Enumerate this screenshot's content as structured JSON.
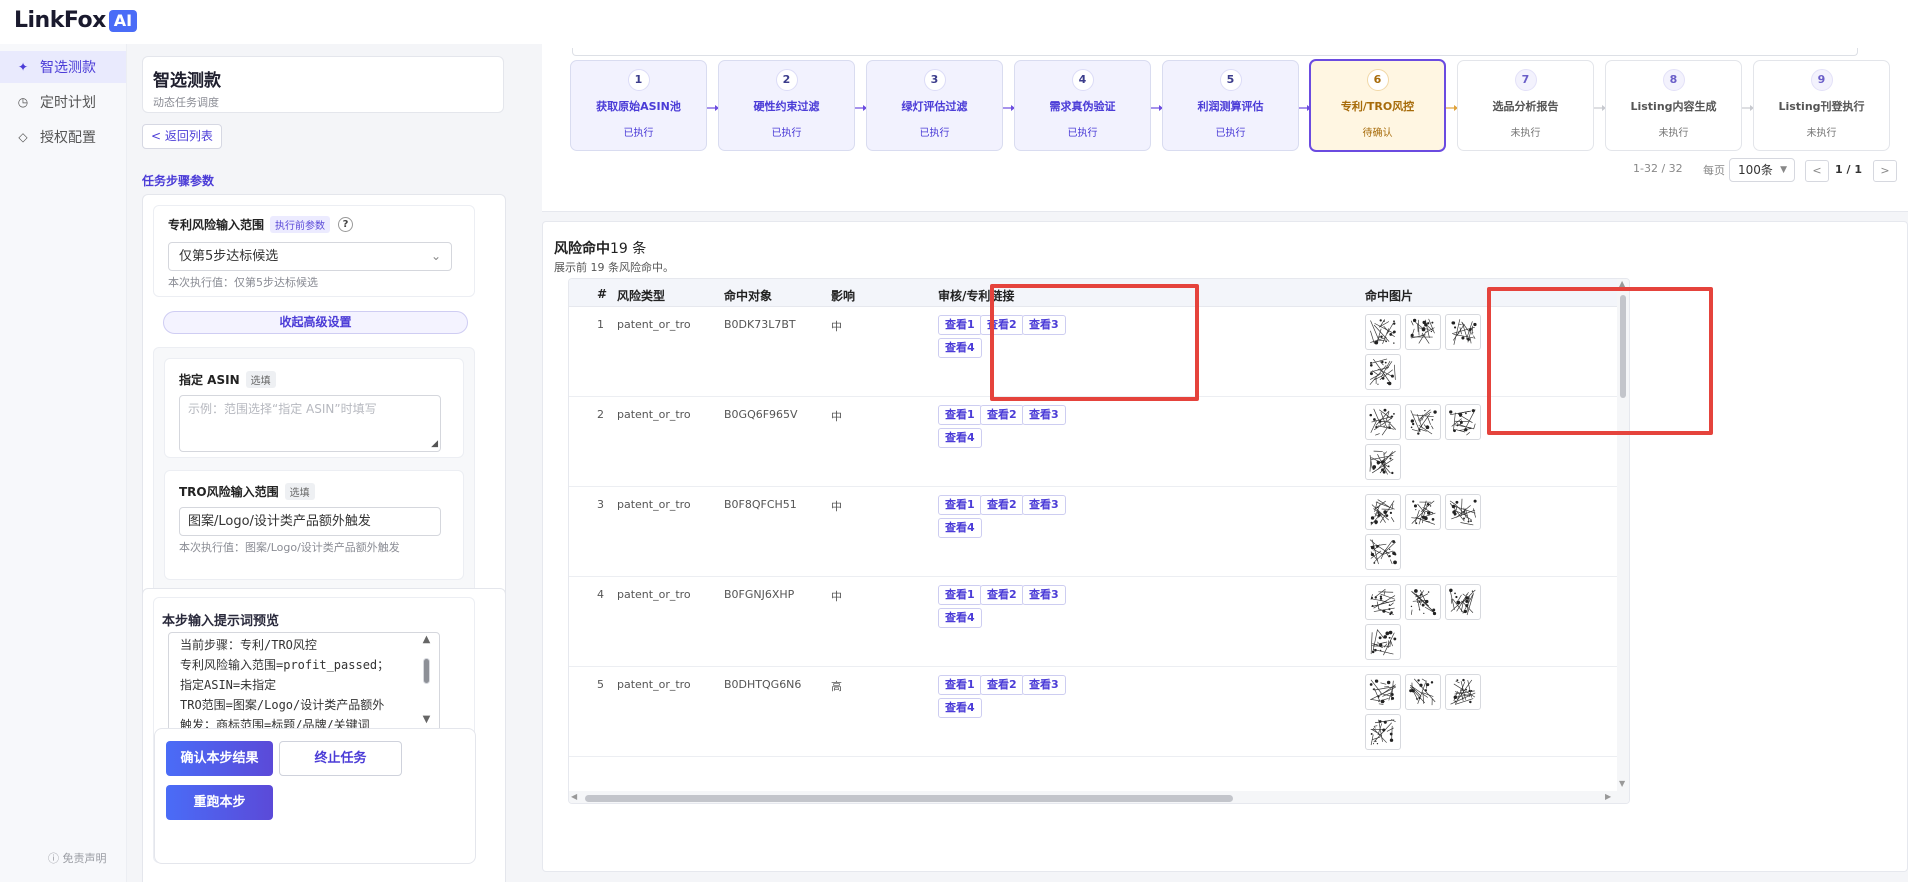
{
  "brand": {
    "name": "LinkFox",
    "badge": "AI"
  },
  "nav": {
    "items": [
      {
        "label": "智选测款",
        "icon": "sparkle-icon",
        "active": true
      },
      {
        "label": "定时计划",
        "icon": "clock-icon",
        "active": false
      },
      {
        "label": "授权配置",
        "icon": "diamond-icon",
        "active": false
      }
    ],
    "disclaimer": "免责声明"
  },
  "config": {
    "title": "智选测款",
    "subtitle": "动态任务调度",
    "back_label": "< 返回列表",
    "section_title": "任务步骤参数",
    "patent_scope": {
      "label": "专利风险输入范围",
      "tag": "执行前参数",
      "help": "?",
      "value": "仅第5步达标候选",
      "current": "本次执行值：仅第5步达标候选"
    },
    "collapse_label": "收起高级设置",
    "asin": {
      "label": "指定 ASIN",
      "tag": "选填",
      "placeholder": "示例：范围选择“指定 ASIN”时填写"
    },
    "tro": {
      "label": "TRO风险输入范围",
      "tag": "选填",
      "value": "图案/Logo/设计类产品额外触发",
      "current": "本次执行值：图案/Logo/设计类产品额外触发"
    },
    "prompt": {
      "title": "本步输入提示词预览",
      "lines": [
        "当前步骤：专利/TRO风控",
        "专利风险输入范围=profit_passed；",
        "指定ASIN=未指定",
        "TRO范围=图案/Logo/设计类产品额外",
        "触发；商标范围=标题/品牌/关键词"
      ]
    },
    "buttons": {
      "confirm": "确认本步结果",
      "stop": "终止任务",
      "rerun": "重跑本步"
    }
  },
  "steps": [
    {
      "num": "1",
      "name": "获取原始ASIN池",
      "status": "已执行",
      "state": "done"
    },
    {
      "num": "2",
      "name": "硬性约束过滤",
      "status": "已执行",
      "state": "done"
    },
    {
      "num": "3",
      "name": "绿灯评估过滤",
      "status": "已执行",
      "state": "done"
    },
    {
      "num": "4",
      "name": "需求真伪验证",
      "status": "已执行",
      "state": "done"
    },
    {
      "num": "5",
      "name": "利润测算评估",
      "status": "已执行",
      "state": "done"
    },
    {
      "num": "6",
      "name": "专利/TRO风控",
      "status": "待确认",
      "state": "active"
    },
    {
      "num": "7",
      "name": "选品分析报告",
      "status": "未执行",
      "state": "pending"
    },
    {
      "num": "8",
      "name": "Listing内容生成",
      "status": "未执行",
      "state": "pending"
    },
    {
      "num": "9",
      "name": "Listing刊登执行",
      "status": "未执行",
      "state": "pending"
    }
  ],
  "pagination": {
    "range": "1-32 / 32",
    "per_page_label": "每页",
    "per_page": "100条",
    "prev": "<",
    "page": "1 / 1",
    "next": ">"
  },
  "results": {
    "title_bold": "风险命中",
    "title_count": "19 条",
    "subtitle": "展示前 19 条风险命中。",
    "columns": [
      "#",
      "风险类型",
      "命中对象",
      "影响",
      "审核/专利链接",
      "命中图片"
    ],
    "links": [
      "查看1",
      "查看2",
      "查看3",
      "查看4"
    ],
    "rows": [
      {
        "idx": "1",
        "type": "patent_or_tro",
        "target": "B0DK73L7BT",
        "impact": "中",
        "images": 4
      },
      {
        "idx": "2",
        "type": "patent_or_tro",
        "target": "B0GQ6F965V",
        "impact": "中",
        "images": 4
      },
      {
        "idx": "3",
        "type": "patent_or_tro",
        "target": "B0F8QFCH51",
        "impact": "中",
        "images": 4
      },
      {
        "idx": "4",
        "type": "patent_or_tro",
        "target": "B0FGNJ6XHP",
        "impact": "中",
        "images": 4
      },
      {
        "idx": "5",
        "type": "patent_or_tro",
        "target": "B0DHTQG6N6",
        "impact": "高",
        "images": 4
      }
    ]
  },
  "colors": {
    "accent": "#4b3cd7",
    "highlight": "#e5433c",
    "active_step_bg": "#fff6e2",
    "active_step_text": "#a76b0a"
  }
}
